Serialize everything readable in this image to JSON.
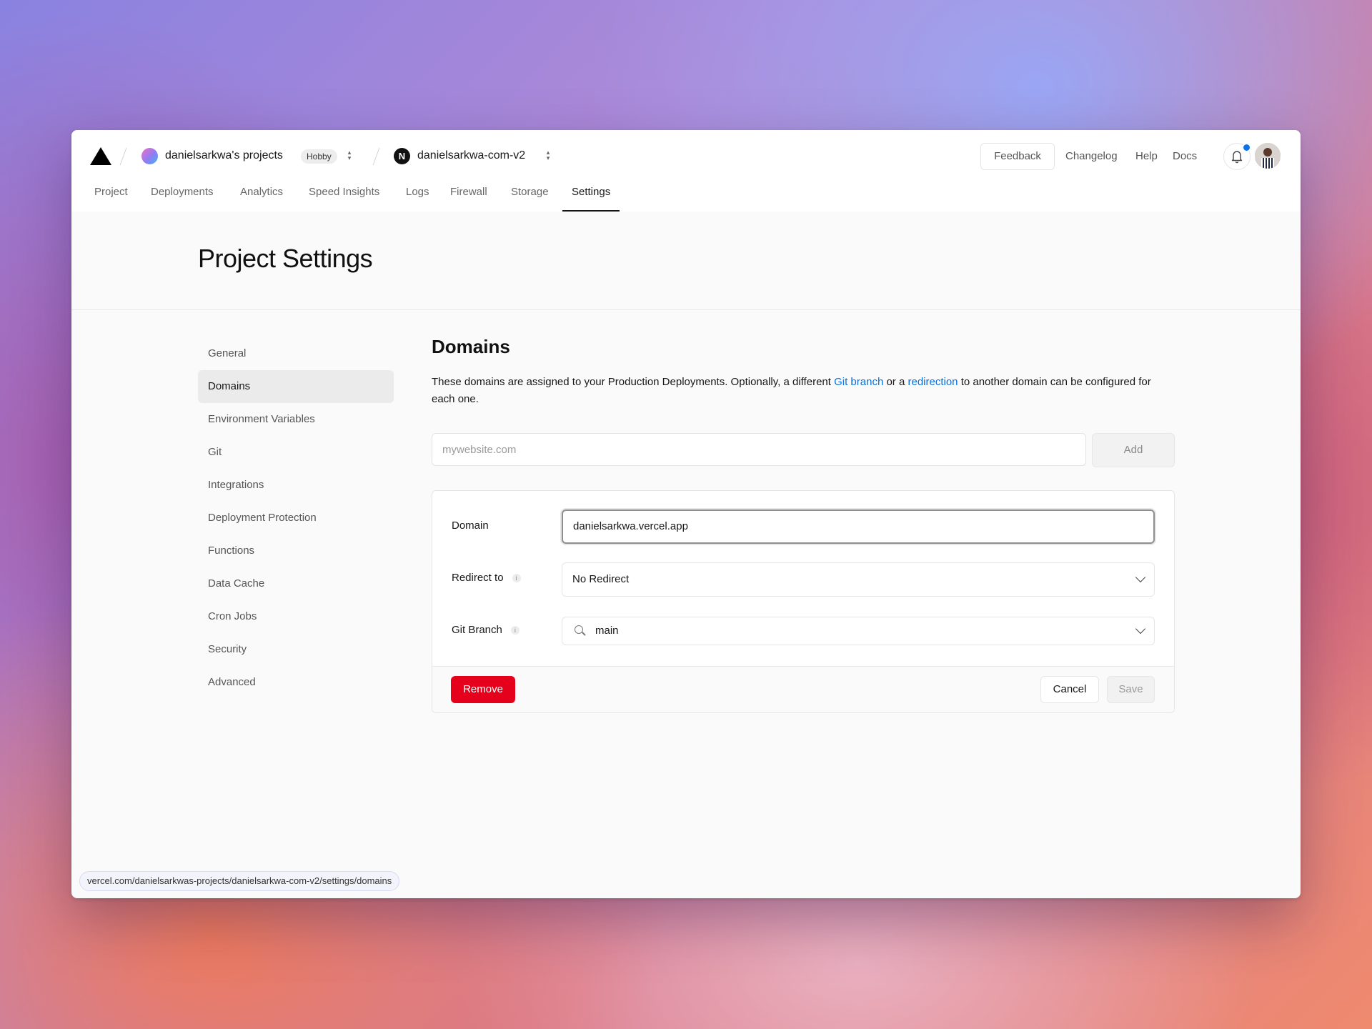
{
  "header": {
    "team_name": "danielsarkwa's projects",
    "plan_badge": "Hobby",
    "project_icon_letter": "N",
    "project_name": "danielsarkwa-com-v2",
    "feedback": "Feedback",
    "changelog": "Changelog",
    "help": "Help",
    "docs": "Docs",
    "notification_dot_color": "#0a72ef"
  },
  "tabs": [
    {
      "label": "Project"
    },
    {
      "label": "Deployments"
    },
    {
      "label": "Analytics"
    },
    {
      "label": "Speed Insights"
    },
    {
      "label": "Logs"
    },
    {
      "label": "Firewall"
    },
    {
      "label": "Storage"
    },
    {
      "label": "Settings",
      "active": true
    }
  ],
  "page_title": "Project Settings",
  "sidebar": {
    "items": [
      {
        "label": "General"
      },
      {
        "label": "Domains",
        "active": true
      },
      {
        "label": "Environment Variables"
      },
      {
        "label": "Git"
      },
      {
        "label": "Integrations"
      },
      {
        "label": "Deployment Protection"
      },
      {
        "label": "Functions"
      },
      {
        "label": "Data Cache"
      },
      {
        "label": "Cron Jobs"
      },
      {
        "label": "Security"
      },
      {
        "label": "Advanced"
      }
    ]
  },
  "domains": {
    "title": "Domains",
    "desc_part1": "These domains are assigned to your Production Deployments. Optionally, a different ",
    "desc_link1": "Git branch",
    "desc_part2": " or a ",
    "desc_link2": "redirection",
    "desc_part3": " to another domain can be configured for each one.",
    "input_placeholder": "mywebsite.com",
    "add_label": "Add",
    "card": {
      "domain_label": "Domain",
      "domain_value": "danielsarkwa.vercel.app",
      "redirect_label": "Redirect to",
      "redirect_value": "No Redirect",
      "branch_label": "Git Branch",
      "branch_value": "main",
      "info_glyph": "i",
      "remove_label": "Remove",
      "cancel_label": "Cancel",
      "save_label": "Save"
    }
  },
  "status_url": "vercel.com/danielsarkwas-projects/danielsarkwa-com-v2/settings/domains",
  "colors": {
    "accent_link": "#0a6fdc",
    "danger": "#e5001c"
  }
}
